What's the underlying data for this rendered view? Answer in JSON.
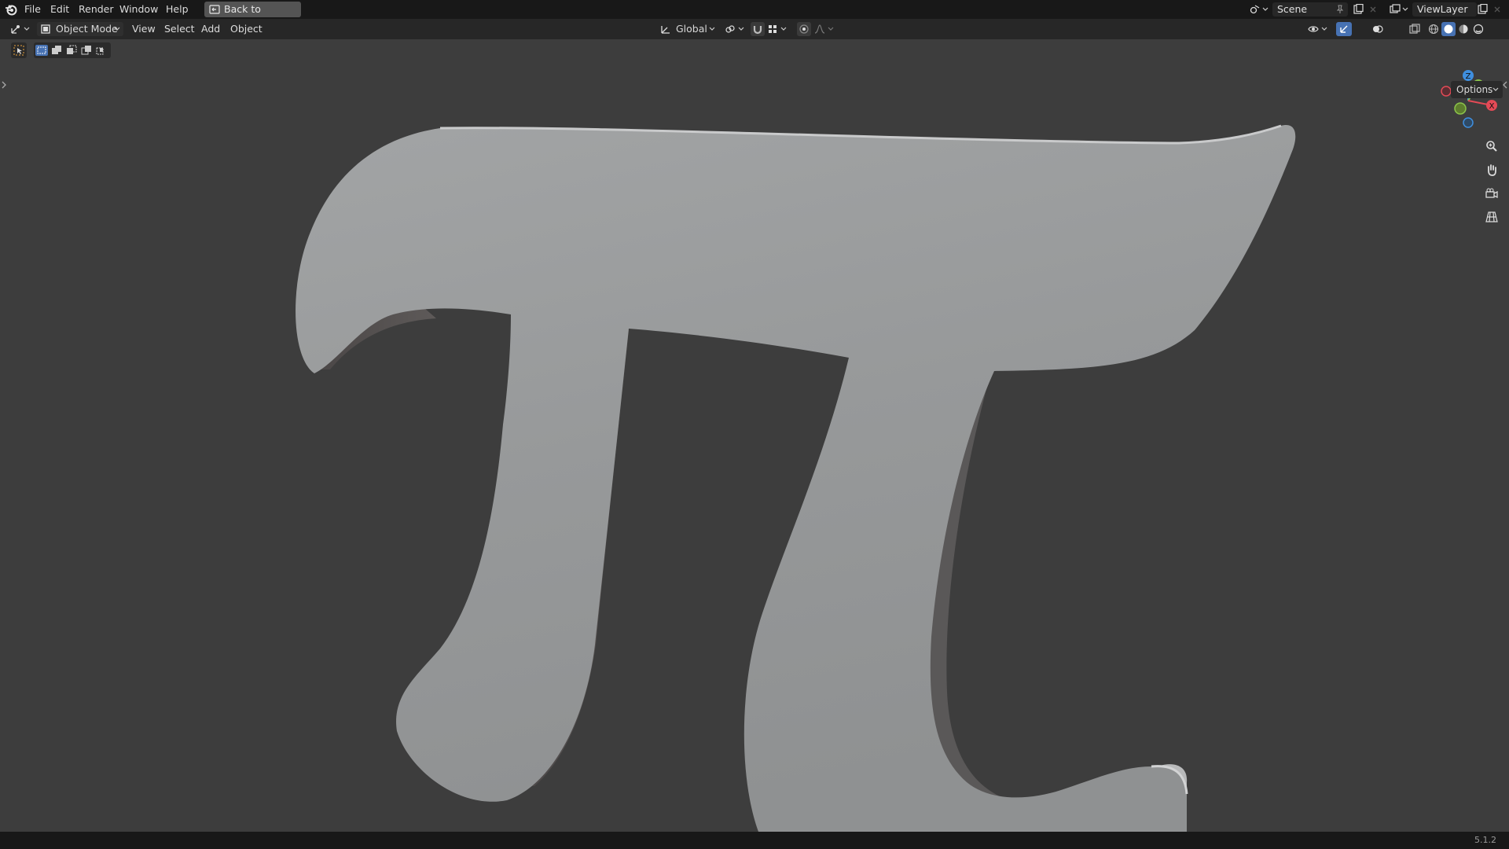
{
  "topbar": {
    "menu": [
      "File",
      "Edit",
      "Render",
      "Window",
      "Help"
    ],
    "back_button": "Back to Previous",
    "scene_name": "Scene",
    "view_layer_name": "ViewLayer"
  },
  "header": {
    "mode": "Object Mode",
    "menu": [
      "View",
      "Select",
      "Add",
      "Object"
    ],
    "transform_orientation": "Global"
  },
  "viewport": {
    "options_label": "Options",
    "gizmo_axes": [
      "Z",
      "Y",
      "X"
    ]
  },
  "statusbar": {
    "version": "5.1.2"
  },
  "colors": {
    "accent": "#4772b3",
    "x_axis": "#e44a56",
    "y_axis": "#8bc34a",
    "z_axis": "#3f8fdf"
  }
}
